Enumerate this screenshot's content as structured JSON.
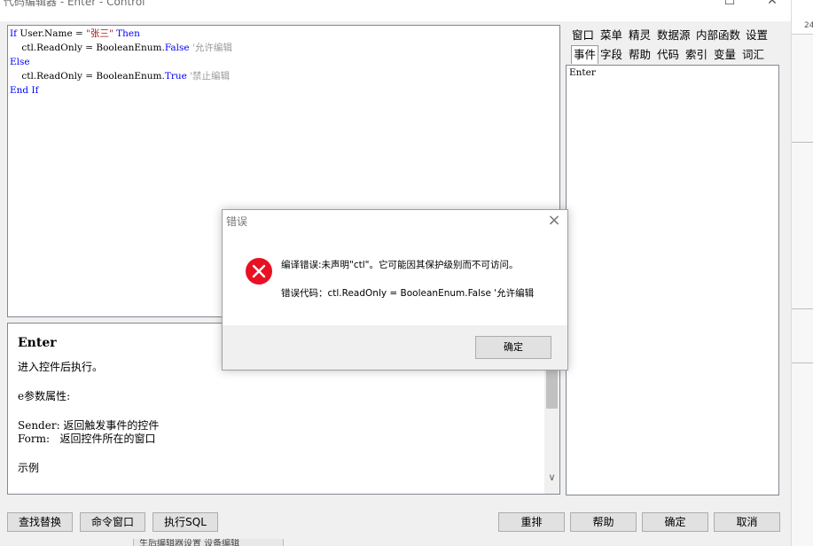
{
  "window": {
    "title": "代码编辑器 - Enter - Control",
    "minimize_glyph": "☐",
    "close_glyph": "✕"
  },
  "editor": {
    "lines": [
      [
        {
          "t": "If",
          "c": "kw"
        },
        {
          "t": " User.Name = ",
          "c": "tx"
        },
        {
          "t": "\"张三\"",
          "c": "str"
        },
        {
          "t": " ",
          "c": "tx"
        },
        {
          "t": "Then",
          "c": "kw"
        }
      ],
      [
        {
          "t": "    ctl.ReadOnly = BooleanEnum.",
          "c": "tx"
        },
        {
          "t": "False",
          "c": "kw"
        },
        {
          "t": " '允许编辑",
          "c": "cmt"
        }
      ],
      [
        {
          "t": "Else",
          "c": "kw"
        }
      ],
      [
        {
          "t": "    ctl.ReadOnly = BooleanEnum.",
          "c": "tx"
        },
        {
          "t": "True",
          "c": "kw"
        },
        {
          "t": " '禁止编辑",
          "c": "cmt"
        }
      ],
      [
        {
          "t": "End If",
          "c": "kw"
        }
      ]
    ]
  },
  "help": {
    "title": "Enter",
    "line1": "进入控件后执行。",
    "line2": "e参数属性:",
    "line3": "Sender: 返回触发事件的控件",
    "line4": "Form:   返回控件所在的窗口",
    "line5": "示例"
  },
  "tabs": {
    "row1": [
      "窗口",
      "菜单",
      "精灵",
      "数据源",
      "内部函数",
      "设置"
    ],
    "row2": [
      "事件",
      "字段",
      "帮助",
      "代码",
      "索引",
      "变量",
      "词汇"
    ],
    "active": "事件"
  },
  "event_list": {
    "items": [
      "Enter"
    ]
  },
  "buttons": {
    "find_replace": "查找替换",
    "command_window": "命令窗口",
    "exec_sql": "执行SQL",
    "rearrange": "重排",
    "help": "帮助",
    "ok": "确定",
    "cancel": "取消"
  },
  "dialog": {
    "title": "错误",
    "message": "编译错误:未声明\"ctl\"。它可能因其保护级别而不可访问。",
    "error_code": "错误代码：ctl.ReadOnly = BooleanEnum.False '允许编辑",
    "ok": "确定"
  },
  "background": {
    "ruler_label": "24",
    "taskbar_text": "生后编辑器设置 设备编辑"
  },
  "colors": {
    "keyword": "#0000ff",
    "string": "#a31515",
    "comment": "#9a9a9a",
    "error_icon": "#e81123"
  }
}
